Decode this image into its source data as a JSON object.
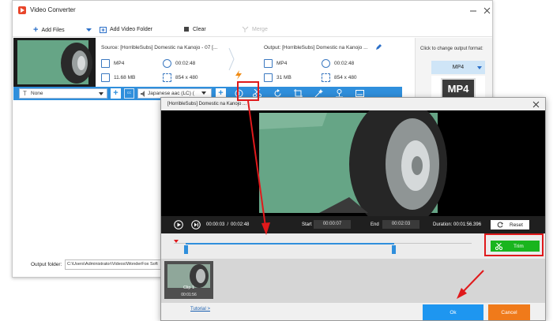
{
  "app": {
    "title": "Video Converter",
    "toolbar": {
      "add_files": "Add Files",
      "add_video_folder": "Add Video Folder",
      "clear": "Clear",
      "merge": "Merge"
    },
    "source": {
      "label": "Source: [HorribleSubs] Domestic na Kanojo - 07 [...",
      "format": "MP4",
      "duration": "00:02:48",
      "size": "11.68 MB",
      "resolution": "854 x 480"
    },
    "output": {
      "label": "Output: [HorribleSubs] Domestic na Kanojo ...",
      "format": "MP4",
      "duration": "00:02:48",
      "size": "31 MB",
      "resolution": "854 x 480"
    },
    "format_panel": {
      "hint": "Click to change output format:",
      "selected": "MP4",
      "badge": "MP4"
    },
    "edit_bar": {
      "subtitle": "None",
      "audio": "Japanese aac (LC) ("
    },
    "output_folder": {
      "label": "Output folder:",
      "path": "C:\\Users\\Administrator\\Videos\\WonderFox Soft"
    }
  },
  "dialog": {
    "title": "[HorribleSubs] Domestic na Kanojo ...",
    "playback": {
      "current": "00:00:03",
      "separator": "/",
      "total": "00:02:48"
    },
    "start_label": "Start",
    "start_value": "00:00:07",
    "end_label": "End",
    "end_value": "00:02:03",
    "duration_label": "Duration: 00:01:56.396",
    "reset_label": "Reset",
    "trim_label": "Trim",
    "trim_range": {
      "start_fraction": 0.04,
      "end_fraction": 0.74
    },
    "clip": {
      "name": "Clip 1",
      "length": "00:01:56"
    },
    "tutorial_link": "Tutorial >",
    "ok_label": "Ok",
    "cancel_label": "Cancel"
  },
  "colors": {
    "accent_blue": "#2f8fdc",
    "highlight_red": "#e0191b",
    "trim_green": "#19b51e",
    "ok_blue": "#1e96f0",
    "cancel_orange": "#f07a1a",
    "car_green": "#66a586"
  },
  "icons": [
    "app-logo-icon",
    "plus-icon",
    "folder-icon",
    "clear-icon",
    "merge-icon",
    "edit-pencil-icon",
    "lightning-icon",
    "scissors-icon",
    "rotate-icon",
    "crop-icon",
    "effects-icon",
    "watermark-icon",
    "subtitle-icon",
    "play-icon",
    "next-frame-icon",
    "reset-icon",
    "close-icon",
    "minimize-icon"
  ]
}
